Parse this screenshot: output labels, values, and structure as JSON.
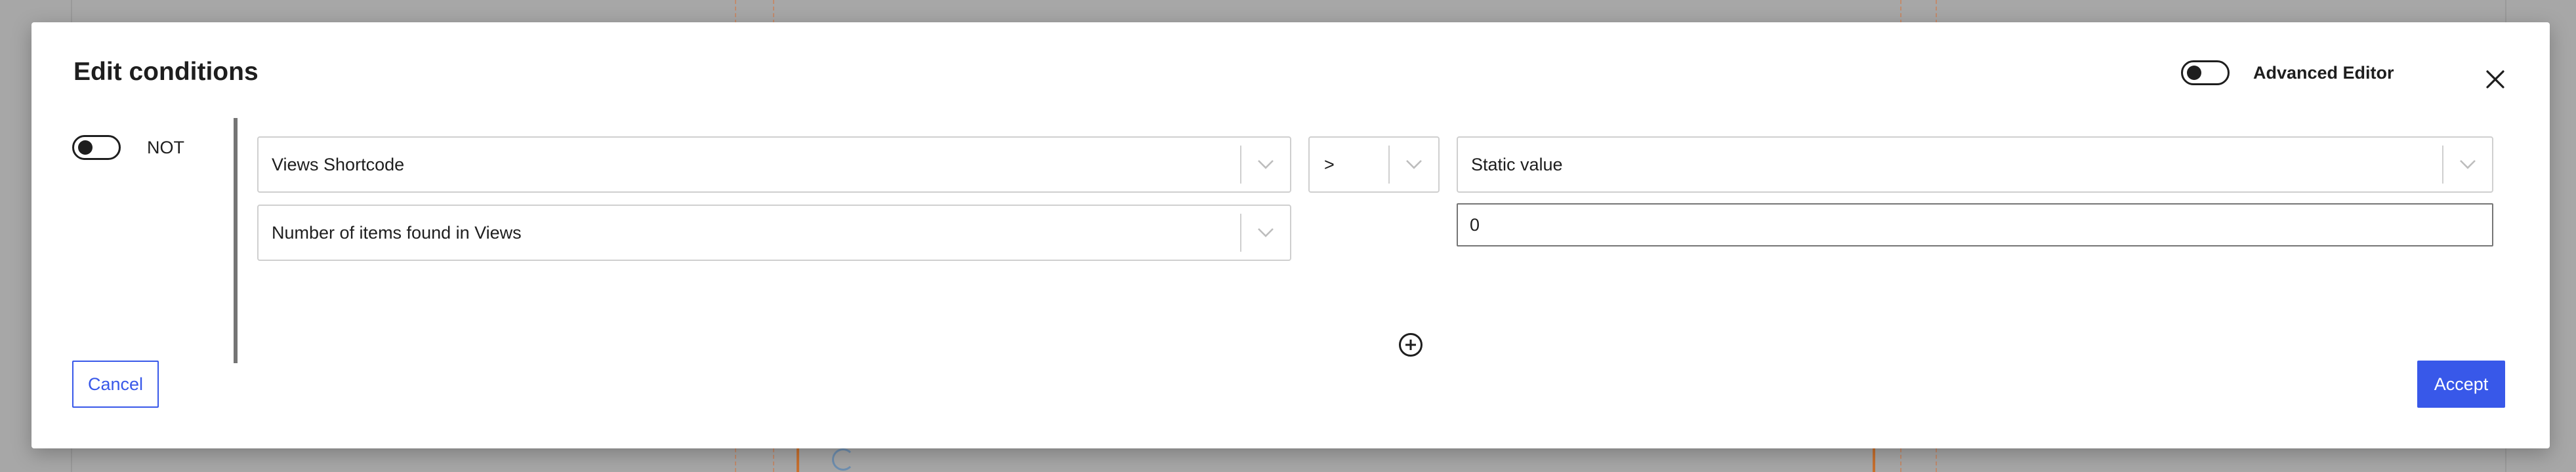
{
  "dialog": {
    "title": "Edit conditions",
    "advanced_editor_label": "Advanced Editor",
    "advanced_editor_on": false
  },
  "condition": {
    "not_label": "NOT",
    "not_on": false,
    "source": "Views Shortcode",
    "field": "Number of items found in Views",
    "operator": ">",
    "value_type": "Static value",
    "value": "0"
  },
  "footer": {
    "cancel_label": "Cancel",
    "accept_label": "Accept"
  },
  "colors": {
    "accent": "#3858e9",
    "text": "#1e1e1e",
    "border": "#cfcfcf"
  },
  "icons": {
    "close": "close-icon",
    "chevron": "chevron-down-icon",
    "add": "add-circle-icon"
  }
}
